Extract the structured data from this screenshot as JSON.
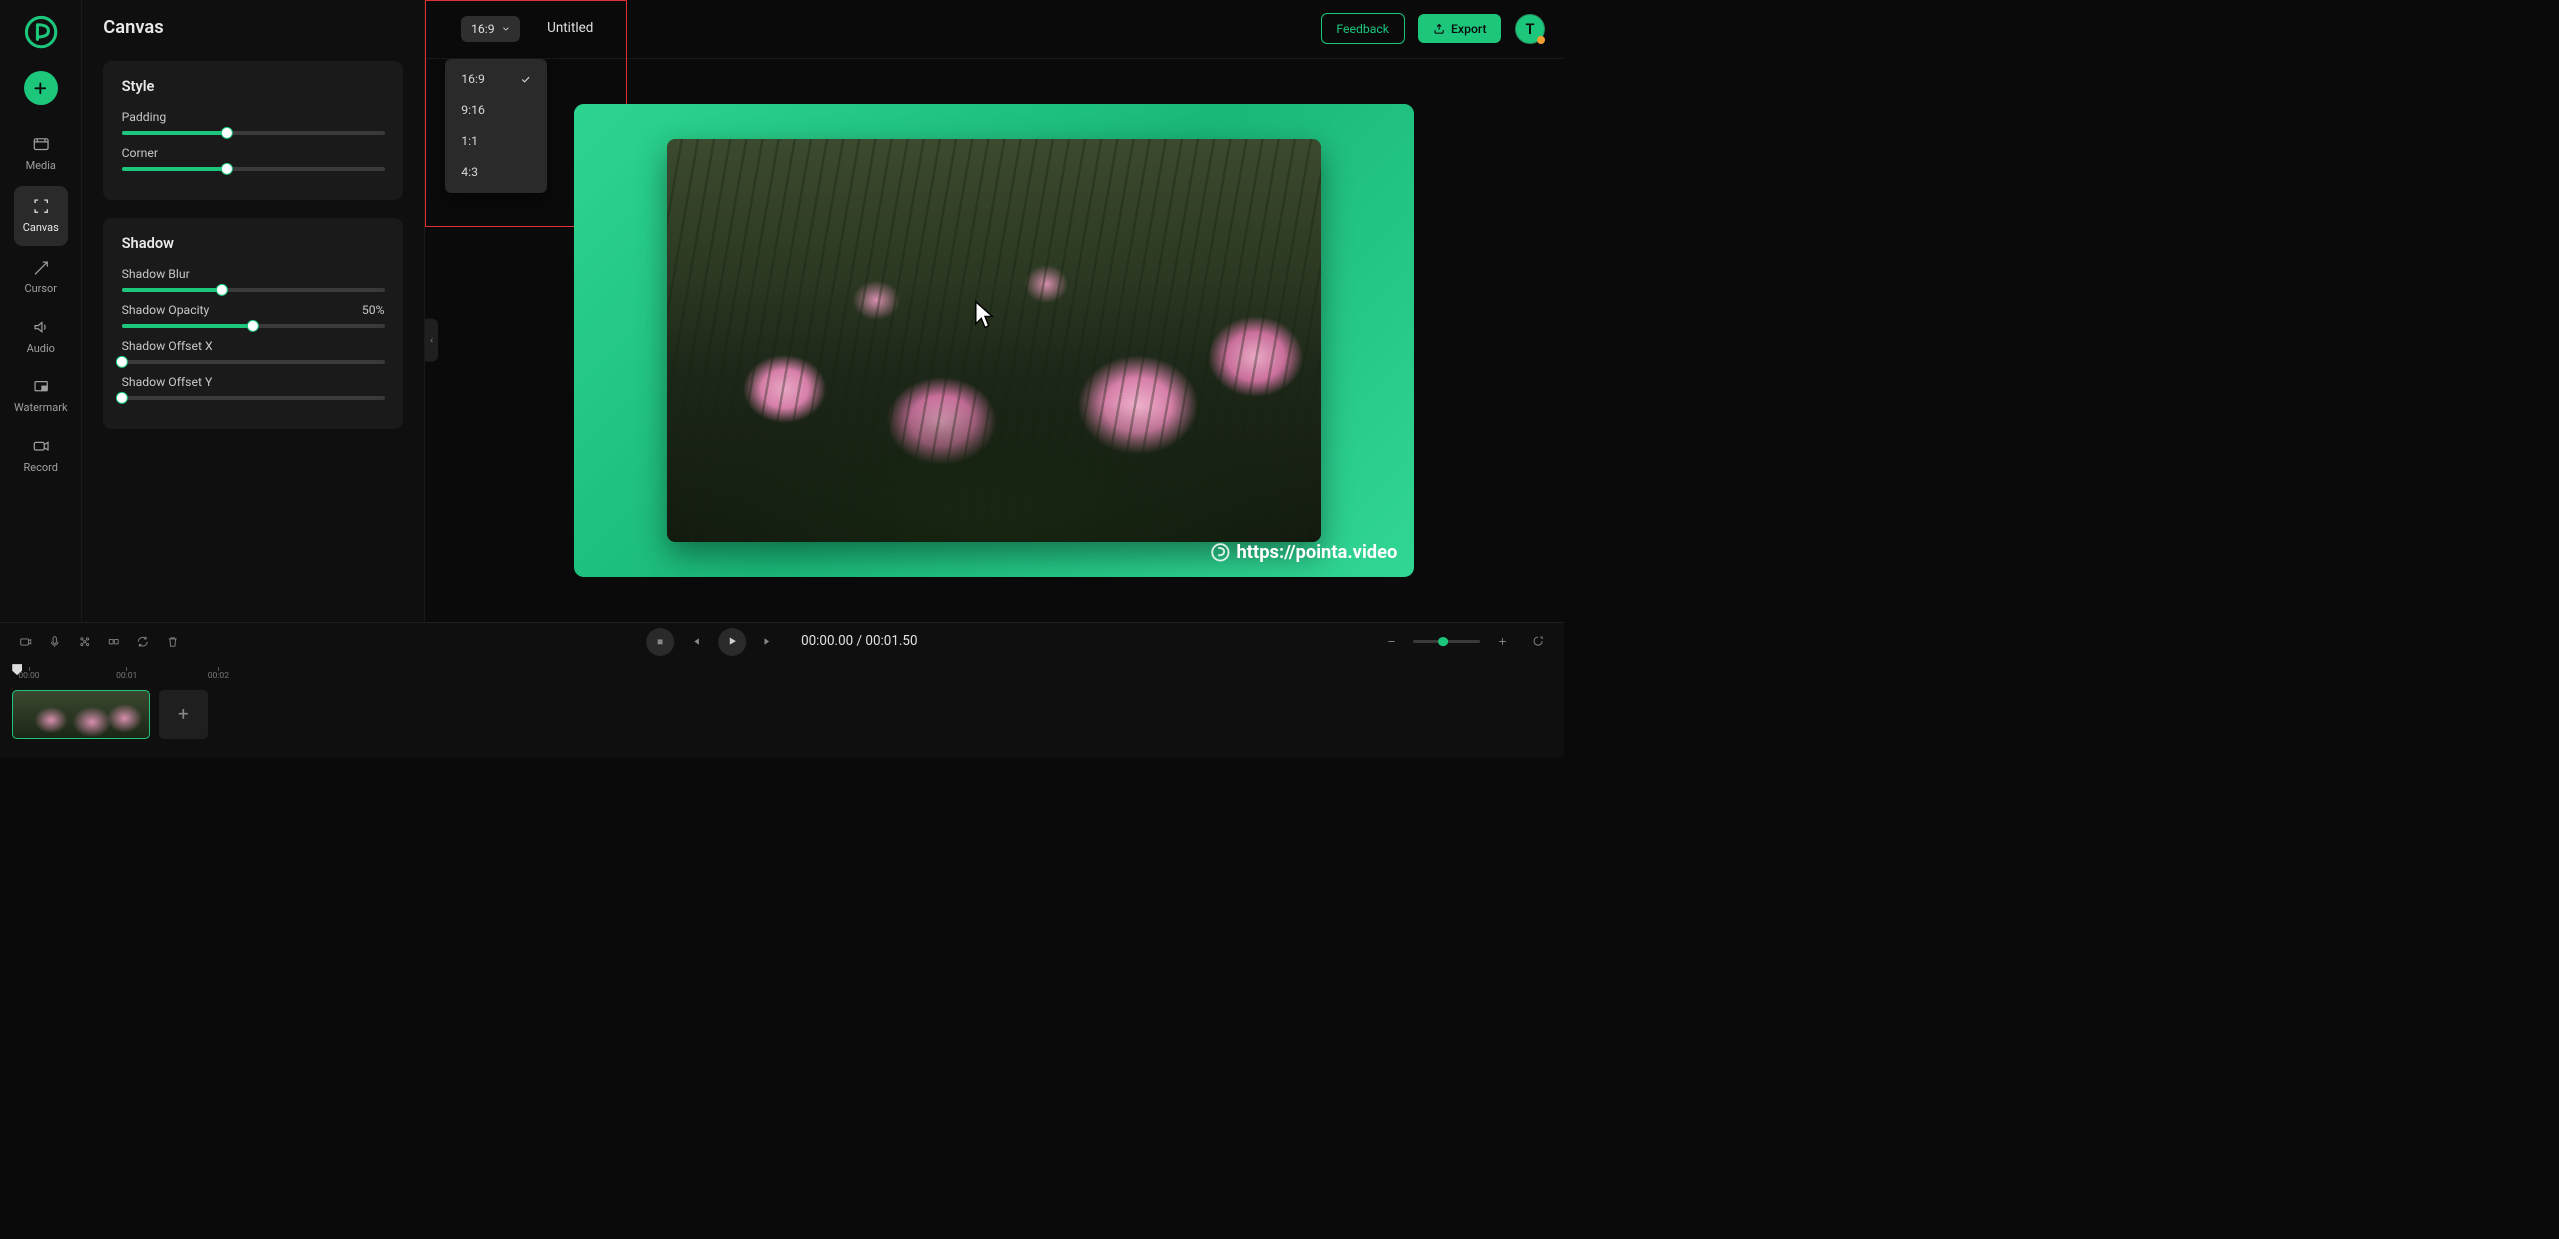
{
  "nav": {
    "items": [
      {
        "key": "media",
        "label": "Media"
      },
      {
        "key": "canvas",
        "label": "Canvas"
      },
      {
        "key": "cursor",
        "label": "Cursor"
      },
      {
        "key": "audio",
        "label": "Audio"
      },
      {
        "key": "watermark",
        "label": "Watermark"
      },
      {
        "key": "record",
        "label": "Record"
      }
    ]
  },
  "sidebar": {
    "title": "Canvas",
    "style": {
      "title": "Style",
      "padding_label": "Padding",
      "padding_pct": 40,
      "corner_label": "Corner",
      "corner_pct": 40
    },
    "shadow": {
      "title": "Shadow",
      "blur_label": "Shadow Blur",
      "blur_pct": 38,
      "opacity_label": "Shadow Opacity",
      "opacity_value": "50%",
      "opacity_pct": 50,
      "offsetx_label": "Shadow Offset X",
      "offsetx_pct": 0,
      "offsety_label": "Shadow Offset Y",
      "offsety_pct": 0
    }
  },
  "topbar": {
    "aspect_label": "16:9",
    "project_title": "Untitled",
    "feedback_label": "Feedback",
    "export_label": "Export",
    "avatar_initial": "T"
  },
  "aspect_dropdown": {
    "options": [
      {
        "label": "16:9",
        "selected": true
      },
      {
        "label": "9:16",
        "selected": false
      },
      {
        "label": "1:1",
        "selected": false
      },
      {
        "label": "4:3",
        "selected": false
      }
    ]
  },
  "preview": {
    "watermark_url": "https://pointa.video"
  },
  "timeline": {
    "current": "00:00.00",
    "sep": " / ",
    "total": "00:01.50",
    "ruler": [
      "00:00",
      "00:01",
      "00:02"
    ]
  }
}
